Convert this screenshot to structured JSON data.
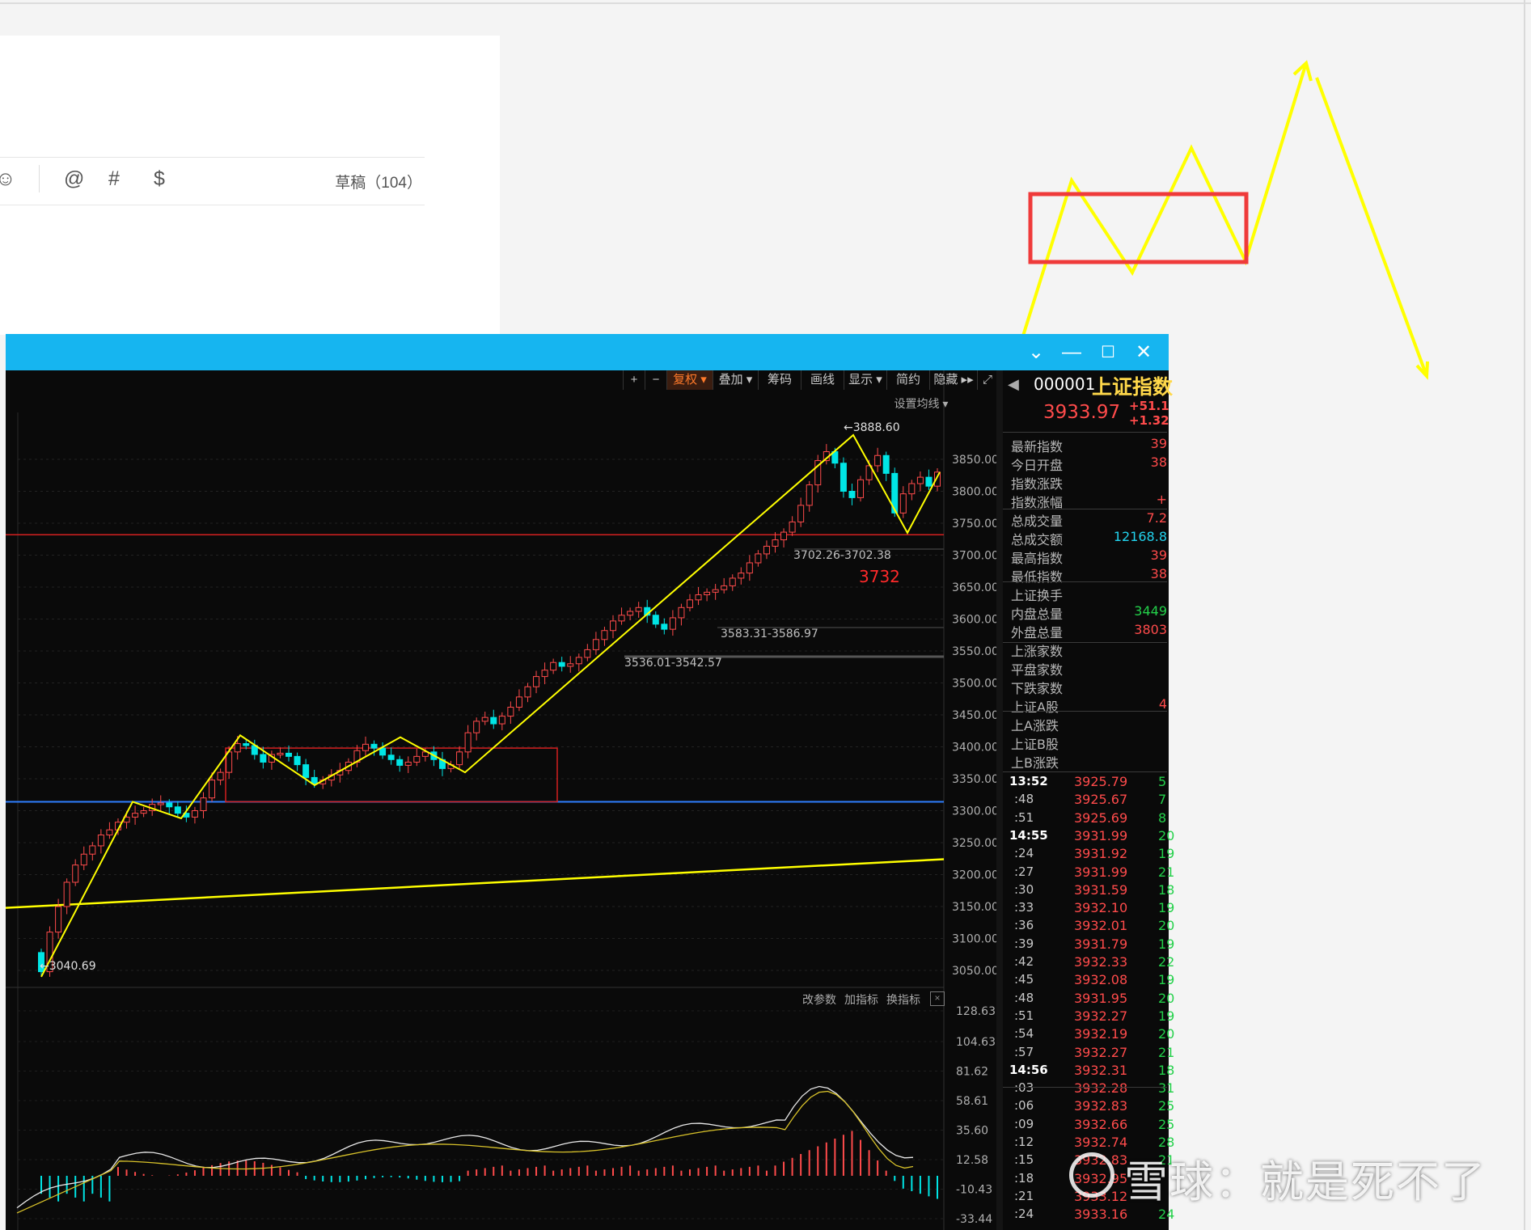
{
  "editor": {
    "toolbar_icons": [
      "☺",
      "@",
      "#",
      "$"
    ],
    "draft_label": "草稿（104）"
  },
  "window": {
    "title_buttons": [
      "chevron-down",
      "minimize",
      "maximize",
      "close"
    ],
    "toolbar": [
      "+",
      "−",
      "复权 ▾",
      "叠加 ▾",
      "筹码",
      "画线",
      "显示 ▾",
      "简约",
      "隐藏 ▸▸"
    ],
    "ma_setting": "设置均线 ▾",
    "indicator_buttons": [
      "改参数",
      "加指标",
      "换指标"
    ]
  },
  "chart_data": {
    "type": "candlestick",
    "price_axis_ticks": [
      "3850.00",
      "3800.00",
      "3750.00",
      "3700.00",
      "3650.00",
      "3600.00",
      "3550.00",
      "3500.00",
      "3450.00",
      "3400.00",
      "3350.00",
      "3300.00",
      "3250.00",
      "3200.00",
      "3150.00",
      "3100.00",
      "3050.00"
    ],
    "ylim": [
      3030,
      3910
    ],
    "annotations": {
      "high": "3888.60",
      "low": "3040.69",
      "gap1": "3702.26-3702.38",
      "gap2": "3583.31-3586.97",
      "gap3": "3536.01-3542.57",
      "level_label": "3732"
    },
    "support_line_price": 3314,
    "resistance_line_price": 3732,
    "zigzag_prices": [
      3040,
      3314,
      3288,
      3418,
      3340,
      3415,
      3360,
      3888,
      3735,
      3830
    ],
    "candles_close": [
      3048,
      3110,
      3150,
      3188,
      3215,
      3232,
      3245,
      3262,
      3270,
      3282,
      3290,
      3296,
      3300,
      3310,
      3312,
      3306,
      3296,
      3290,
      3300,
      3320,
      3348,
      3360,
      3392,
      3405,
      3402,
      3388,
      3376,
      3388,
      3390,
      3385,
      3372,
      3352,
      3342,
      3348,
      3356,
      3363,
      3376,
      3394,
      3404,
      3398,
      3387,
      3380,
      3371,
      3376,
      3385,
      3392,
      3380,
      3366,
      3372,
      3392,
      3422,
      3440,
      3446,
      3436,
      3448,
      3462,
      3478,
      3494,
      3510,
      3520,
      3532,
      3526,
      3530,
      3540,
      3552,
      3568,
      3582,
      3597,
      3606,
      3612,
      3618,
      3606,
      3592,
      3584,
      3602,
      3618,
      3630,
      3638,
      3642,
      3646,
      3652,
      3664,
      3672,
      3688,
      3702,
      3714,
      3724,
      3736,
      3752,
      3778,
      3810,
      3848,
      3862,
      3844,
      3800,
      3790,
      3818,
      3840,
      3856,
      3828,
      3766,
      3796,
      3812,
      3822,
      3808,
      3830
    ],
    "macd_axis_ticks": [
      "128.63",
      "104.63",
      "81.62",
      "58.61",
      "35.60",
      "12.58",
      "-10.43",
      "-33.44"
    ],
    "macd_ylim": [
      -33.44,
      128.63
    ]
  },
  "quote": {
    "code": "000001",
    "name": "上证指数",
    "price": "3933.97",
    "change": "+51.1",
    "change_pct": "+1.32",
    "stats": [
      {
        "label": "最新指数",
        "value": "39"
      },
      {
        "label": "今日开盘",
        "value": "38"
      },
      {
        "label": "指数涨跌",
        "value": ""
      },
      {
        "label": "指数涨幅",
        "value": "+"
      },
      {
        "label": "总成交量",
        "value": "7.2"
      },
      {
        "label": "总成交额",
        "value": "12168.8"
      },
      {
        "label": "最高指数",
        "value": "39"
      },
      {
        "label": "最低指数",
        "value": "38"
      },
      {
        "label": "上证换手",
        "value": ""
      },
      {
        "label": "内盘总量",
        "value": "3449"
      },
      {
        "label": "外盘总量",
        "value": "3803"
      },
      {
        "label": "上涨家数",
        "value": ""
      },
      {
        "label": "平盘家数",
        "value": ""
      },
      {
        "label": "下跌家数",
        "value": ""
      },
      {
        "label": "上证A股",
        "value": "4"
      },
      {
        "label": "上A涨跌",
        "value": ""
      },
      {
        "label": "上证B股",
        "value": ""
      },
      {
        "label": "上B涨跌",
        "value": ""
      }
    ],
    "ticks": [
      {
        "time": "13:52",
        "price": "3925.79",
        "vol": "5"
      },
      {
        "time": ":48",
        "price": "3925.67",
        "vol": "7"
      },
      {
        "time": ":51",
        "price": "3925.69",
        "vol": "8"
      },
      {
        "time": "14:55",
        "price": "3931.99",
        "vol": "20"
      },
      {
        "time": ":24",
        "price": "3931.92",
        "vol": "19"
      },
      {
        "time": ":27",
        "price": "3931.99",
        "vol": "21"
      },
      {
        "time": ":30",
        "price": "3931.59",
        "vol": "18"
      },
      {
        "time": ":33",
        "price": "3932.10",
        "vol": "19"
      },
      {
        "time": ":36",
        "price": "3932.01",
        "vol": "20"
      },
      {
        "time": ":39",
        "price": "3931.79",
        "vol": "19"
      },
      {
        "time": ":42",
        "price": "3932.33",
        "vol": "22"
      },
      {
        "time": ":45",
        "price": "3932.08",
        "vol": "19"
      },
      {
        "time": ":48",
        "price": "3931.95",
        "vol": "20"
      },
      {
        "time": ":51",
        "price": "3932.27",
        "vol": "19"
      },
      {
        "time": ":54",
        "price": "3932.19",
        "vol": "20"
      },
      {
        "time": ":57",
        "price": "3932.27",
        "vol": "21"
      },
      {
        "time": "14:56",
        "price": "3932.31",
        "vol": "18"
      },
      {
        "time": ":03",
        "price": "3932.28",
        "vol": "31"
      },
      {
        "time": ":06",
        "price": "3932.83",
        "vol": "25"
      },
      {
        "time": ":09",
        "price": "3932.66",
        "vol": "25"
      },
      {
        "time": ":12",
        "price": "3932.74",
        "vol": "28"
      },
      {
        "time": ":15",
        "price": "3932.83",
        "vol": "21"
      },
      {
        "time": ":18",
        "price": "3932.95",
        "vol": ""
      },
      {
        "time": ":21",
        "price": "3933.12",
        "vol": ""
      },
      {
        "time": ":24",
        "price": "3933.16",
        "vol": "24"
      }
    ]
  },
  "watermark": "雪球：就是死不了",
  "colors": {
    "titlebar": "#16b5f0",
    "up": "#ff4b4b",
    "down": "#00e5e5",
    "zigzag": "#ffff00",
    "support": "#2f7fff",
    "resistance": "#d42020",
    "box": "#ff3b3b"
  }
}
